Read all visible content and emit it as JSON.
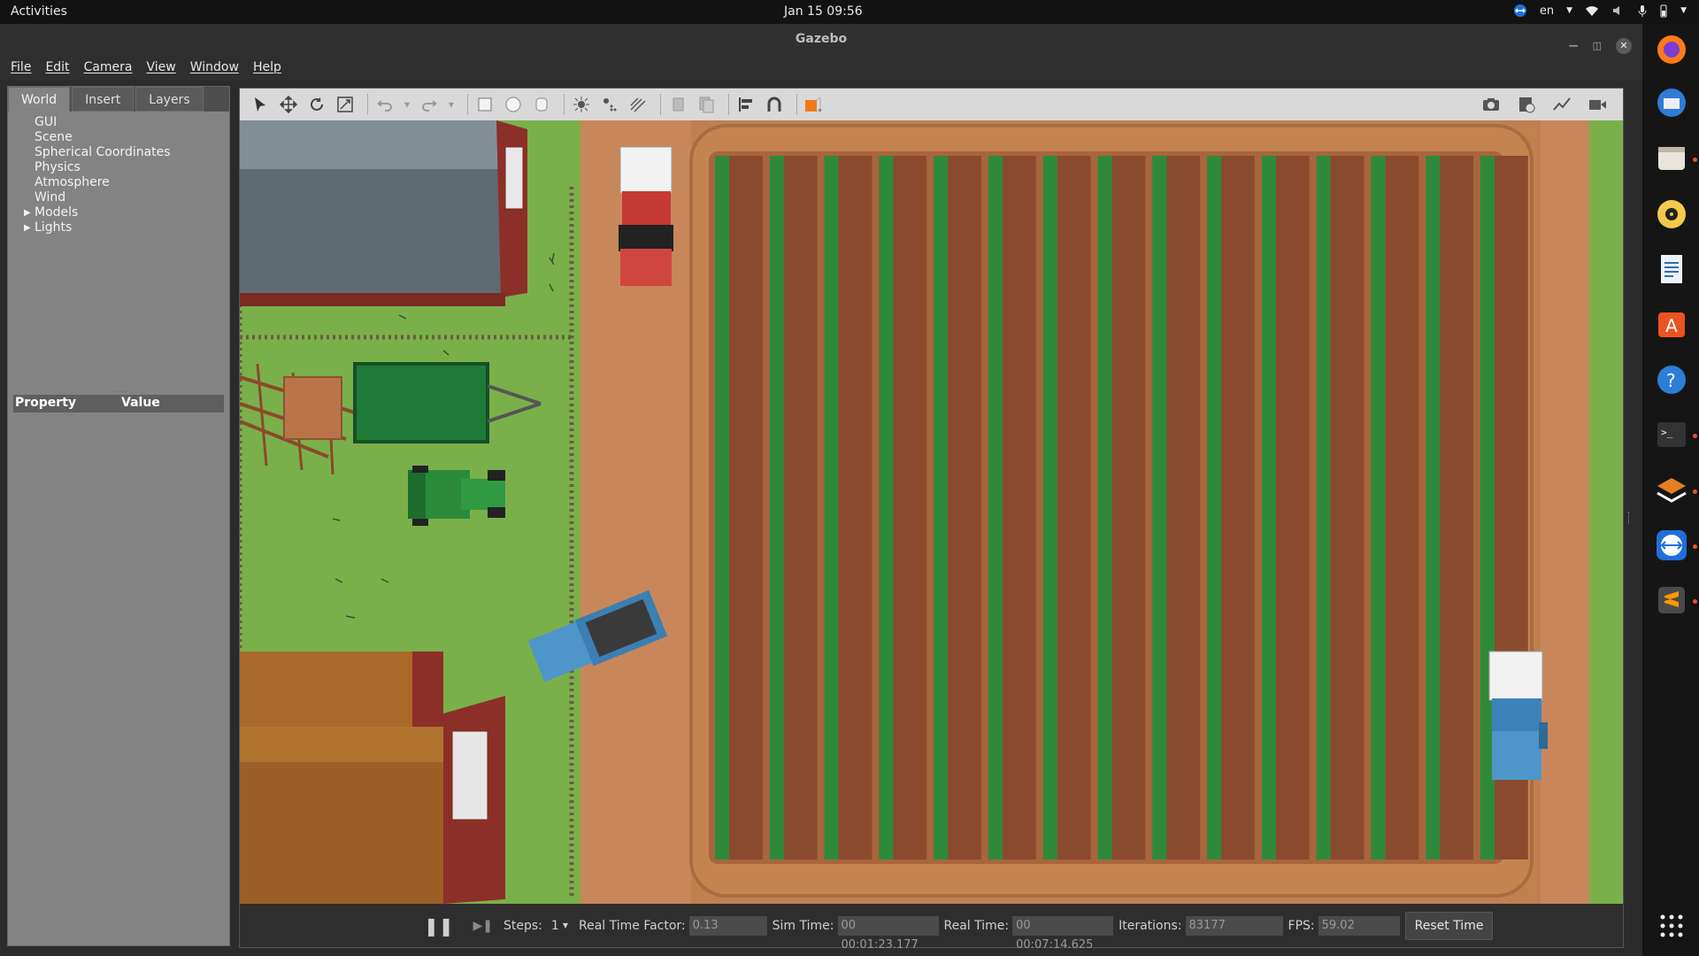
{
  "topbar": {
    "activities": "Activities",
    "clock": "Jan 15  09:56",
    "lang": "en"
  },
  "window": {
    "title": "Gazebo"
  },
  "menu": [
    "File",
    "Edit",
    "Camera",
    "View",
    "Window",
    "Help"
  ],
  "left_panel": {
    "tabs": [
      "World",
      "Insert",
      "Layers"
    ],
    "active_tab": "World",
    "tree": [
      "GUI",
      "Scene",
      "Spherical Coordinates",
      "Physics",
      "Atmosphere",
      "Wind",
      "Models",
      "Lights"
    ],
    "property_header": "Property",
    "value_header": "Value"
  },
  "toolbar": {
    "tools": [
      "select-icon",
      "translate-icon",
      "rotate-icon",
      "scale-icon",
      "undo-icon",
      "redo-icon",
      "box-icon",
      "sphere-icon",
      "cylinder-icon",
      "point-light-icon",
      "spot-light-icon",
      "directional-light-icon",
      "copy-icon",
      "paste-icon",
      "align-icon",
      "snap-icon",
      "view-angle-icon"
    ],
    "right_tools": [
      "screenshot-icon",
      "log-icon",
      "plot-icon",
      "record-icon"
    ]
  },
  "status": {
    "steps_label": "Steps:",
    "steps_value": "1",
    "rtf_label": "Real Time Factor:",
    "rtf_value": "0.13",
    "sim_label": "Sim Time:",
    "sim_value": "00 00:01:23.177",
    "real_label": "Real Time:",
    "real_value": "00 00:07:14.625",
    "iter_label": "Iterations:",
    "iter_value": "83177",
    "fps_label": "FPS:",
    "fps_value": "59.02",
    "reset_label": "Reset Time"
  },
  "dock": [
    "firefox-icon",
    "thunderbird-icon",
    "files-icon",
    "rhythmbox-icon",
    "writer-icon",
    "software-center-icon",
    "help-icon",
    "terminal-icon",
    "layers-app-icon",
    "teamviewer-icon",
    "sublime-icon",
    "app-grid-icon"
  ],
  "colors": {
    "grass": "#7ab04a",
    "dirt": "#c68557",
    "furrow": "#8a4a2d",
    "plant": "#2e8a3a",
    "accent": "#e95420"
  }
}
